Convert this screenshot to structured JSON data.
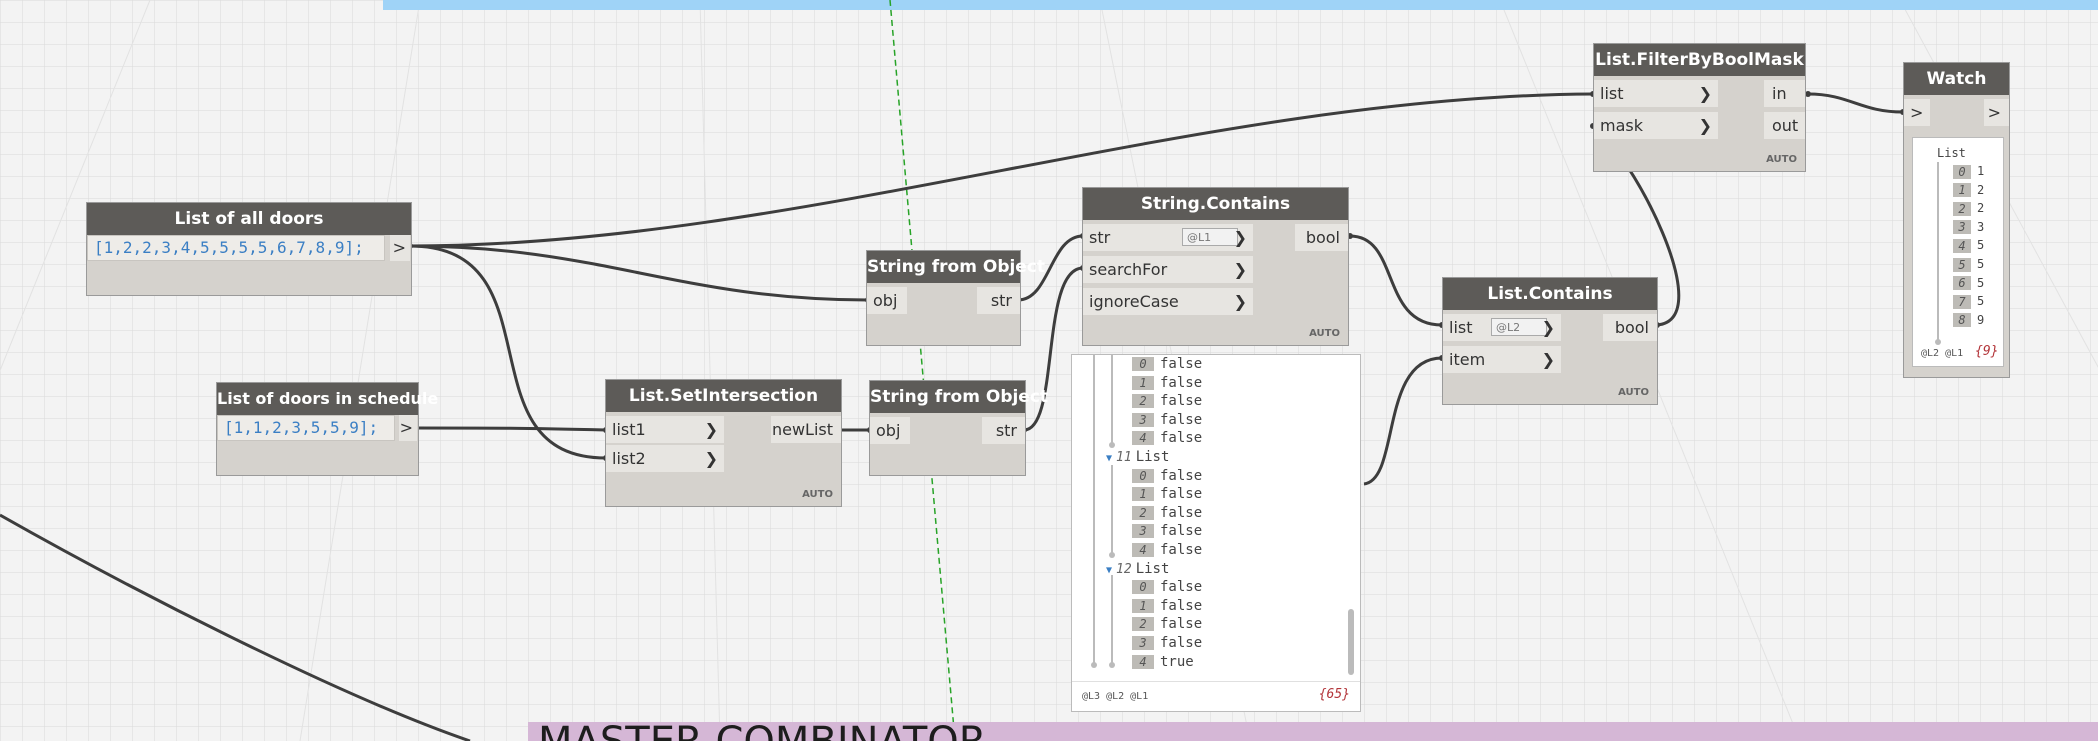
{
  "nodes": {
    "all_doors": {
      "title": "List of all doors",
      "code": "[1,2,2,3,4,5,5,5,5,6,7,8,9];",
      "out": ">"
    },
    "schedule_doors": {
      "title": "List of doors in schedule",
      "code": "[1,1,2,3,5,5,9];",
      "out": ">"
    },
    "set_intersection": {
      "title": "List.SetIntersection",
      "inputs": [
        "list1",
        "list2"
      ],
      "output": "newList",
      "mode": "AUTO"
    },
    "string_from_object_1": {
      "title": "String from Object",
      "input": "obj",
      "output": "str"
    },
    "string_from_object_2": {
      "title": "String from Object",
      "input": "obj",
      "output": "str"
    },
    "string_contains": {
      "title": "String.Contains",
      "inputs": [
        "str",
        "searchFor",
        "ignoreCase"
      ],
      "output": "bool",
      "lacing": "@L1",
      "mode": "AUTO"
    },
    "list_contains": {
      "title": "List.Contains",
      "inputs": [
        "list",
        "item"
      ],
      "output": "bool",
      "lacing": "@L2",
      "mode": "AUTO"
    },
    "filter_by_bool_mask": {
      "title": "List.FilterByBoolMask",
      "inputs": [
        "list",
        "mask"
      ],
      "outputs": [
        "in",
        "out"
      ],
      "mode": "AUTO"
    },
    "watch": {
      "title": "Watch",
      "in": ">",
      "out": ">",
      "list_label": "List",
      "items": [
        {
          "i": "0",
          "v": "1"
        },
        {
          "i": "1",
          "v": "2"
        },
        {
          "i": "2",
          "v": "2"
        },
        {
          "i": "3",
          "v": "3"
        },
        {
          "i": "4",
          "v": "5"
        },
        {
          "i": "5",
          "v": "5"
        },
        {
          "i": "6",
          "v": "5"
        },
        {
          "i": "7",
          "v": "5"
        },
        {
          "i": "8",
          "v": "9"
        }
      ],
      "levels": "@L2 @L1",
      "count": "{9}"
    }
  },
  "preview": {
    "rows": [
      {
        "type": "item",
        "i": "0",
        "v": "false"
      },
      {
        "type": "item",
        "i": "1",
        "v": "false"
      },
      {
        "type": "item",
        "i": "2",
        "v": "false"
      },
      {
        "type": "item",
        "i": "3",
        "v": "false"
      },
      {
        "type": "item",
        "i": "4",
        "v": "false"
      },
      {
        "type": "list",
        "i": "11",
        "v": "List"
      },
      {
        "type": "item",
        "i": "0",
        "v": "false"
      },
      {
        "type": "item",
        "i": "1",
        "v": "false"
      },
      {
        "type": "item",
        "i": "2",
        "v": "false"
      },
      {
        "type": "item",
        "i": "3",
        "v": "false"
      },
      {
        "type": "item",
        "i": "4",
        "v": "false"
      },
      {
        "type": "list",
        "i": "12",
        "v": "List"
      },
      {
        "type": "item",
        "i": "0",
        "v": "false"
      },
      {
        "type": "item",
        "i": "1",
        "v": "false"
      },
      {
        "type": "item",
        "i": "2",
        "v": "false"
      },
      {
        "type": "item",
        "i": "3",
        "v": "false"
      },
      {
        "type": "item",
        "i": "4",
        "v": "true"
      }
    ],
    "levels": "@L3 @L2 @L1",
    "count": "{65}"
  },
  "group": {
    "title": "MASTER COMBINATOR"
  },
  "colors": {
    "node_header": "#5d5b58",
    "node_body": "#d5d2cd",
    "wire": "#3d3d3d",
    "group": "#d5b7d6",
    "top_bar": "#9fd3f7"
  }
}
